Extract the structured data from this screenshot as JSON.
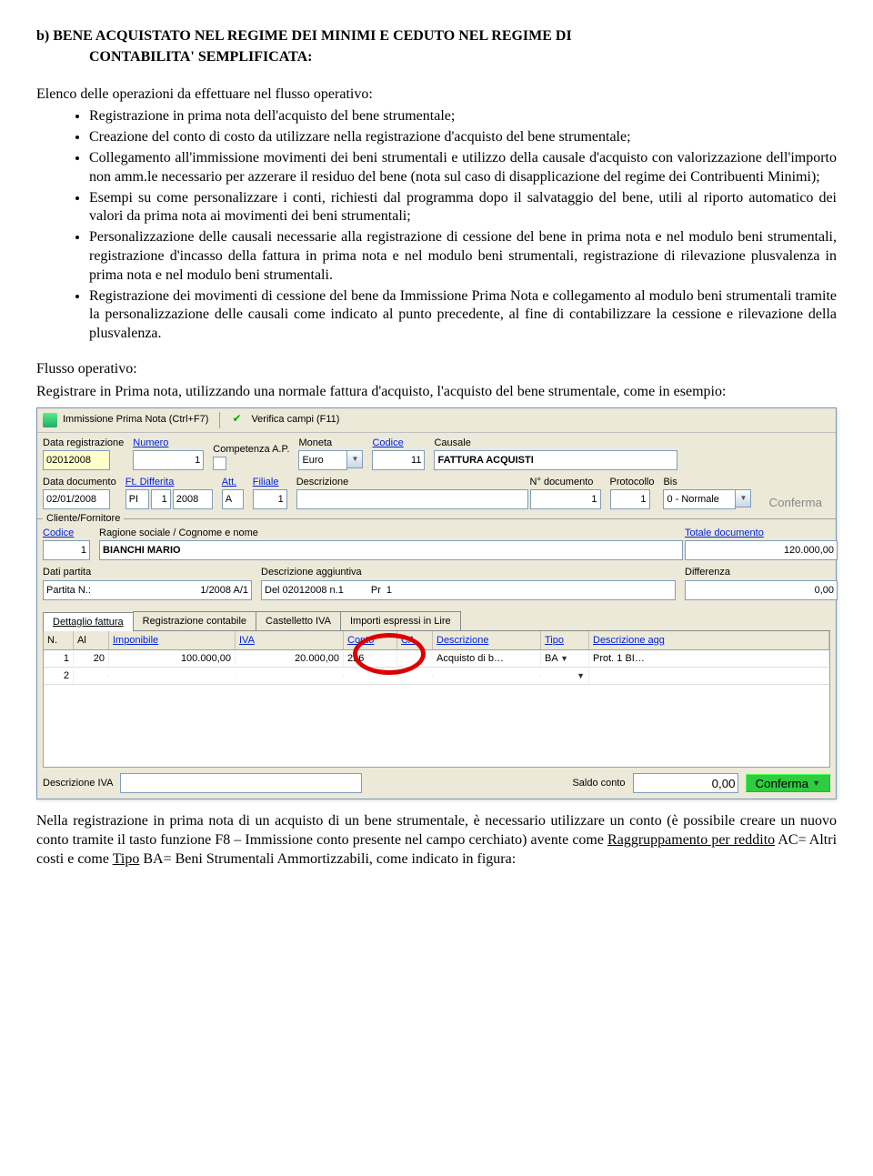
{
  "title_a": "b)  BENE ACQUISTATO NEL REGIME DEI MINIMI E CEDUTO NEL REGIME DI",
  "title_b": "CONTABILITA' SEMPLIFICATA:",
  "intro": "Elenco delle operazioni da effettuare nel flusso operativo:",
  "bullets": [
    "Registrazione in prima nota dell'acquisto del bene strumentale;",
    "Creazione del conto di costo da utilizzare nella registrazione d'acquisto del bene strumentale;",
    "Collegamento all'immissione movimenti dei beni strumentali e utilizzo della causale d'acquisto con valorizzazione dell'importo non amm.le necessario per azzerare il residuo del bene (nota sul caso di disapplicazione del regime dei Contribuenti Minimi);",
    "Esempi su come personalizzare i conti, richiesti dal programma dopo il salvataggio del bene, utili al riporto automatico dei valori da prima nota ai movimenti dei beni strumentali;",
    "Personalizzazione delle causali necessarie alla registrazione di cessione del bene in prima nota e nel modulo beni strumentali, registrazione d'incasso della fattura in prima nota e nel modulo beni strumentali, registrazione di rilevazione plusvalenza in prima nota e nel modulo beni strumentali.",
    "Registrazione dei movimenti di cessione del bene da Immissione Prima Nota e collegamento al modulo beni strumentali tramite la personalizzazione delle causali come indicato al punto precedente, al fine di contabilizzare la cessione e rilevazione della plusvalenza."
  ],
  "flow_label": "Flusso operativo:",
  "flow_text": "Registrare in Prima nota, utilizzando una normale fattura d'acquisto, l'acquisto del bene strumentale, come in esempio:",
  "toolbar": {
    "imm": "Immissione Prima Nota (Ctrl+F7)",
    "ver": "Verifica campi (F11)"
  },
  "row1": {
    "data_reg_lbl": "Data registrazione",
    "numero_lbl": "Numero",
    "competenza_lbl": "Competenza A.P.",
    "moneta_lbl": "Moneta",
    "codice_lbl": "Codice",
    "causale_lbl": "Causale",
    "data_reg_val": "02012008",
    "numero_val": "1",
    "moneta_val": "Euro",
    "codice_val": "11",
    "causale_val": "FATTURA ACQUISTI"
  },
  "row2": {
    "data_doc_lbl": "Data documento",
    "ft_diff_lbl": "Ft. Differita",
    "att_lbl": "Att.",
    "filiale_lbl": "Filiale",
    "descr_lbl": "Descrizione",
    "ndoc_lbl": "N° documento",
    "prot_lbl": "Protocollo",
    "bis_lbl": "Bis",
    "data_doc_val": "02/01/2008",
    "pi_val": "PI",
    "anno_val": "2008",
    "att_val": "A",
    "filiale_val": "1",
    "ndoc_val": "1",
    "prot_val": "1",
    "bis_val": "0 - Normale",
    "conferma": "Conferma",
    "one": "1"
  },
  "cliente": {
    "section": "Cliente/Fornitore",
    "codice_lbl": "Codice",
    "rag_lbl": "Ragione sociale / Cognome e nome",
    "tot_lbl": "Totale documento",
    "codice_val": "1",
    "rag_val": "BIANCHI MARIO",
    "tot_val": "120.000,00"
  },
  "dati": {
    "dati_lbl": "Dati partita",
    "descr_lbl": "Descrizione aggiuntiva",
    "diff_lbl": "Differenza",
    "partita_lbl": "Partita N.:",
    "partita_val": "1/2008  A/1",
    "del_val": "Del 02012008 n.1",
    "pr_lbl": "Pr",
    "pr_val": "1",
    "diff_val": "0,00"
  },
  "tabs": {
    "t1": "Dettaglio fattura",
    "t2": "Registrazione contabile",
    "t3": "Castelletto IVA",
    "t4": "Importi espressi in Lire"
  },
  "grid": {
    "h_n": "N.",
    "h_al": "Al",
    "h_imp": "Imponibile",
    "h_iva": "IVA",
    "h_conto": "Conto",
    "h_ca": "CA",
    "h_descr": "Descrizione",
    "h_tipo": "Tipo",
    "h_descragg": "Descrizione agg",
    "r1_n": "1",
    "r1_al": "20",
    "r1_imp": "100.000,00",
    "r1_iva": "20.000,00",
    "r1_conto": "226",
    "r1_descr": "Acquisto di b…",
    "r1_tipo": "BA",
    "r1_prot": "Prot.   1   BI…",
    "r2_n": "2"
  },
  "bottom": {
    "descr_iva": "Descrizione IVA",
    "saldo_lbl": "Saldo conto",
    "saldo_val": "0,00",
    "conferma": "Conferma"
  },
  "after1": "Nella registrazione in prima nota di un acquisto di un bene strumentale, è necessario utilizzare un conto (è possibile creare un nuovo conto tramite il tasto funzione F8 – Immissione conto presente nel campo cerchiato) avente come ",
  "after_u1": "Raggruppamento per reddito",
  "after2": " AC= Altri costi e come ",
  "after_u2": "Tipo",
  "after3": " BA= Beni Strumentali Ammortizzabili, come indicato in figura:"
}
